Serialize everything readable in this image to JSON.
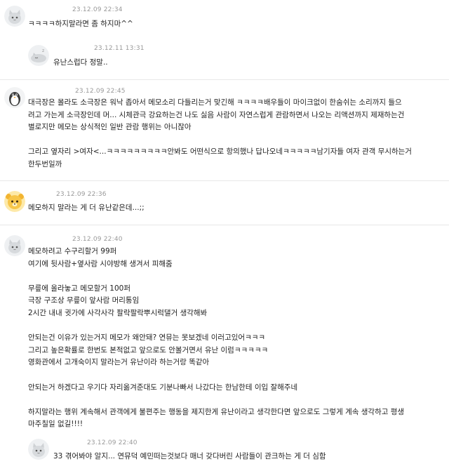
{
  "comments": [
    {
      "date": "23.12.09 22:34",
      "avatar_icon": "cat-face-icon",
      "text": "ㅋㅋㅋㅋ하지말라면 좀 하지마^^"
    },
    {
      "date": "23.12.11 13:31",
      "avatar_icon": "sleeping-cat-icon",
      "reply": true,
      "text": "유난스럽다 정말.."
    },
    {
      "date": "23.12.09 22:45",
      "avatar_icon": "penguin-icon",
      "text": "대극장은 몰라도 소극장은 워낙 좁아서 메모소리 다들리는거 맞긴해 ㅋㅋㅋㅋ배우들이 마이크없이 한숨쉬는 소리까지 들으\n려고 가는게 소극장인데 머... 시체관극 강요하는건 나도 싫음 사람이 자연스럽게 관람하면서 나오는 리액션까지 제재하는건\n별로지만 메모는 상식적인 일반 관람 행위는 아니잖아\n\n그리고 옆자리 >여자<...ㅋㅋㅋㅋㅋㅋㅋㅋㅋ안봐도 어떤식으로 항의했나 답나오네ㅋㅋㅋㅋㅋ남기자들 여자 관객 무시하는거\n한두번일까"
    },
    {
      "date": "23.12.09 22:36",
      "avatar_icon": "yellow-bear-icon",
      "text": "메모하지 말라는 게 더 유난같은데...;;"
    },
    {
      "date": "23.12.09 22:40",
      "avatar_icon": "cat-face-icon",
      "text": "메모하려고 수구리할거 99퍼\n여기에 뒷사람+옆사람 시야방해 생겨서 피해줌\n\n무릎에 올라놓고 메모할거 100퍼\n극장 구조상 무릎이 앞사람 머리통임\n2시간 내내 귓가에 사각사각 팔락팔락뿌시럭댈거 생각해봐\n\n안되는건 이유가 있는거지 메모가 왜안돼? 연뮤는 못보겠네 이러고있어ㅋㅋㅋ\n그리고 높은확률로 한번도 본적없고 앞으로도 안볼거면서 유난 이럼ㅋㅋㅋㅋㅋ\n영화관에서 고개숙이지 말라는거 유난이라 하는거랑 똑같아\n\n안되는거 하겠다고 우기다 자리옮겨준대도 기분나빠서 나갔다는 한남한테 이입 잘해주네\n\n하지말라는 행위 계속해서 관객에게 불편주는 행동을 제지한게 유난이라고 생각한다면 앞으로도 그렇게 계속 생각하고 평생\n마주칠일 없길!!!!"
    },
    {
      "date": "23.12.09 22:40",
      "avatar_icon": "cat-face-icon",
      "reply": true,
      "text": "33 겪어봐야 알지... 연뮤덕 예민떠는것보다 매너 갖다버린 사람들이 관크하는 게 더 심함"
    }
  ]
}
